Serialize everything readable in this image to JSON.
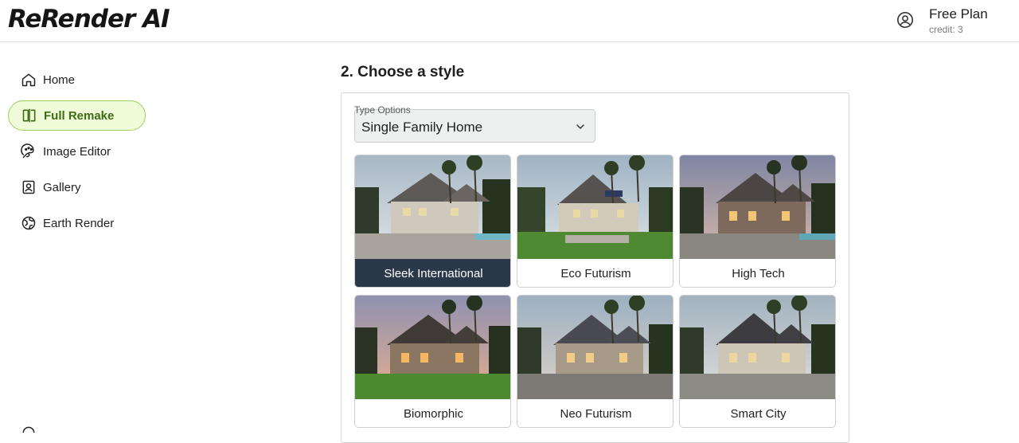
{
  "app": {
    "logo": "ReRender AI"
  },
  "account": {
    "plan": "Free Plan",
    "credit": "credit: 3"
  },
  "sidebar": {
    "items": [
      {
        "label": "Home",
        "icon": "home-icon",
        "active": false
      },
      {
        "label": "Full Remake",
        "icon": "full-remake-icon",
        "active": true
      },
      {
        "label": "Image Editor",
        "icon": "image-editor-icon",
        "active": false
      },
      {
        "label": "Gallery",
        "icon": "gallery-icon",
        "active": false
      },
      {
        "label": "Earth Render",
        "icon": "globe-icon",
        "active": false
      }
    ]
  },
  "main": {
    "section_title": "2. Choose a style",
    "type_select": {
      "label": "Type Options",
      "value": "Single Family Home"
    },
    "styles": [
      {
        "label": "Sleek International",
        "selected": true
      },
      {
        "label": "Eco Futurism",
        "selected": false
      },
      {
        "label": "High Tech",
        "selected": false
      },
      {
        "label": "Biomorphic",
        "selected": false
      },
      {
        "label": "Neo Futurism",
        "selected": false
      },
      {
        "label": "Smart City",
        "selected": false
      }
    ]
  },
  "colors": {
    "accent_bg": "#effbd9",
    "accent_border": "#9ed15f",
    "accent_text": "#3e6b13",
    "selected_label_bg": "#2b384a"
  }
}
